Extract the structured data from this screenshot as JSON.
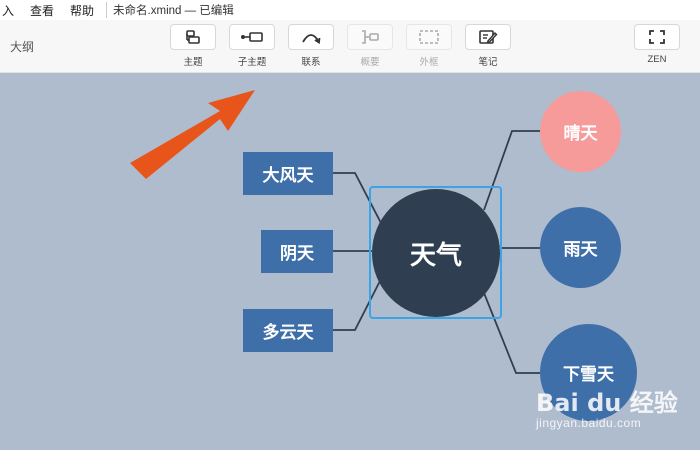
{
  "menu": {
    "items": [
      "入",
      "查看",
      "帮助"
    ],
    "doc_title": "未命名.xmind — 已编辑"
  },
  "toolbar": {
    "outline_label": "大纲",
    "tools": [
      {
        "label": "主题",
        "icon": "topic-icon",
        "enabled": true
      },
      {
        "label": "子主题",
        "icon": "subtopic-icon",
        "enabled": true
      },
      {
        "label": "联系",
        "icon": "relationship-icon",
        "enabled": true
      },
      {
        "label": "概要",
        "icon": "summary-icon",
        "enabled": false
      },
      {
        "label": "外框",
        "icon": "boundary-icon",
        "enabled": false
      },
      {
        "label": "笔记",
        "icon": "note-icon",
        "enabled": true
      },
      {
        "label": "ZEN",
        "icon": "zen-fullscreen-icon",
        "enabled": true
      }
    ]
  },
  "mindmap": {
    "central": "天气",
    "left_topics": [
      "大风天",
      "阴天",
      "多云天"
    ],
    "right_topics": [
      {
        "label": "晴天",
        "color": "#f79a9a"
      },
      {
        "label": "雨天",
        "color": "#3f6fa8"
      },
      {
        "label": "下雪天",
        "color": "#3f6fa8"
      }
    ]
  },
  "colors": {
    "canvas": "#afbcce",
    "central": "#2f3e51",
    "topic": "#3f6fa8",
    "selection": "#3aa4e6",
    "arrow": "#e8551b"
  },
  "watermark": {
    "logo": "Bai du 经验",
    "sub": "jingyan.baidu.com"
  }
}
